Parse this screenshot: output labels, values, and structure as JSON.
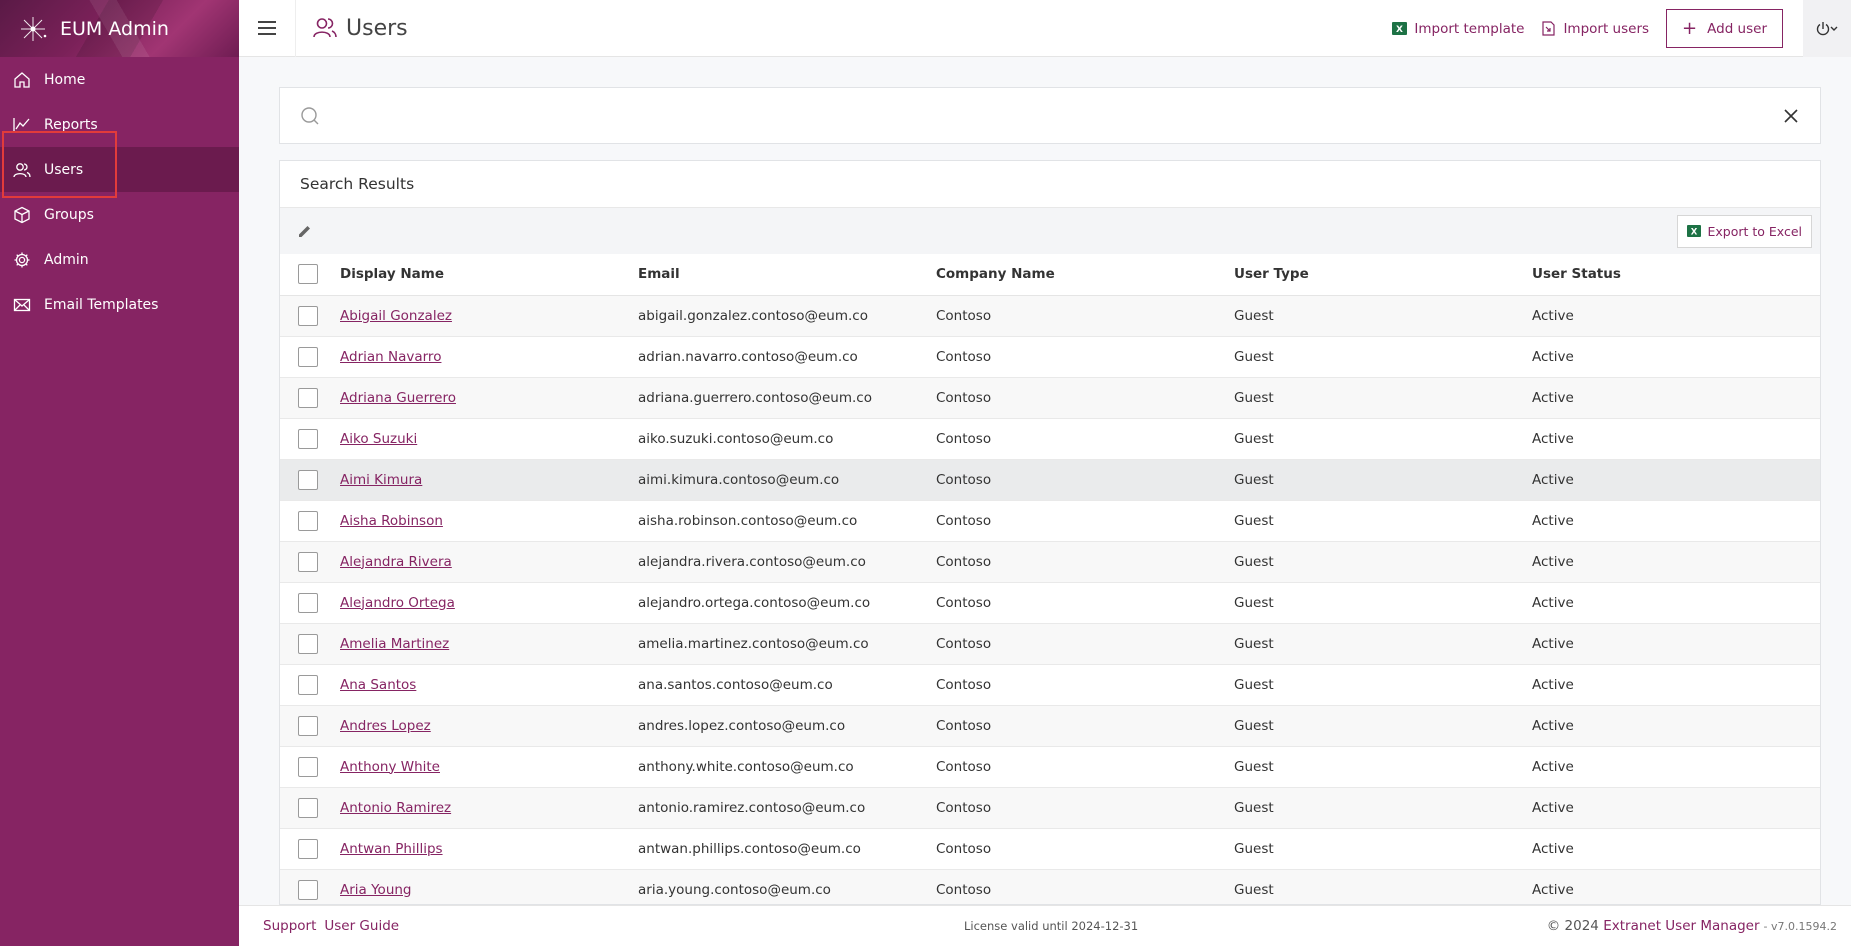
{
  "app": {
    "title": "EUM Admin"
  },
  "sidebar": {
    "items": [
      {
        "label": "Home",
        "icon": "home-icon"
      },
      {
        "label": "Reports",
        "icon": "chart-line-icon"
      },
      {
        "label": "Users",
        "icon": "users-icon",
        "active": true
      },
      {
        "label": "Groups",
        "icon": "cube-icon"
      },
      {
        "label": "Admin",
        "icon": "gear-icon"
      },
      {
        "label": "Email Templates",
        "icon": "envelope-icon"
      }
    ]
  },
  "header": {
    "page_title": "Users",
    "import_template_label": "Import template",
    "import_users_label": "Import users",
    "add_user_label": "Add user"
  },
  "search": {
    "value": "",
    "placeholder": ""
  },
  "results": {
    "title": "Search Results",
    "export_label": "Export to Excel",
    "columns": [
      "Display Name",
      "Email",
      "Company Name",
      "User Type",
      "User Status"
    ],
    "rows": [
      {
        "name": "Abigail Gonzalez",
        "email": "abigail.gonzalez.contoso@eum.co",
        "company": "Contoso",
        "type": "Guest",
        "status": "Active"
      },
      {
        "name": "Adrian Navarro",
        "email": "adrian.navarro.contoso@eum.co",
        "company": "Contoso",
        "type": "Guest",
        "status": "Active"
      },
      {
        "name": "Adriana Guerrero",
        "email": "adriana.guerrero.contoso@eum.co",
        "company": "Contoso",
        "type": "Guest",
        "status": "Active"
      },
      {
        "name": "Aiko Suzuki",
        "email": "aiko.suzuki.contoso@eum.co",
        "company": "Contoso",
        "type": "Guest",
        "status": "Active"
      },
      {
        "name": "Aimi Kimura",
        "email": "aimi.kimura.contoso@eum.co",
        "company": "Contoso",
        "type": "Guest",
        "status": "Active"
      },
      {
        "name": "Aisha Robinson",
        "email": "aisha.robinson.contoso@eum.co",
        "company": "Contoso",
        "type": "Guest",
        "status": "Active"
      },
      {
        "name": "Alejandra Rivera",
        "email": "alejandra.rivera.contoso@eum.co",
        "company": "Contoso",
        "type": "Guest",
        "status": "Active"
      },
      {
        "name": "Alejandro Ortega",
        "email": "alejandro.ortega.contoso@eum.co",
        "company": "Contoso",
        "type": "Guest",
        "status": "Active"
      },
      {
        "name": "Amelia Martinez",
        "email": "amelia.martinez.contoso@eum.co",
        "company": "Contoso",
        "type": "Guest",
        "status": "Active"
      },
      {
        "name": "Ana Santos",
        "email": "ana.santos.contoso@eum.co",
        "company": "Contoso",
        "type": "Guest",
        "status": "Active"
      },
      {
        "name": "Andres Lopez",
        "email": "andres.lopez.contoso@eum.co",
        "company": "Contoso",
        "type": "Guest",
        "status": "Active"
      },
      {
        "name": "Anthony White",
        "email": "anthony.white.contoso@eum.co",
        "company": "Contoso",
        "type": "Guest",
        "status": "Active"
      },
      {
        "name": "Antonio Ramirez",
        "email": "antonio.ramirez.contoso@eum.co",
        "company": "Contoso",
        "type": "Guest",
        "status": "Active"
      },
      {
        "name": "Antwan Phillips",
        "email": "antwan.phillips.contoso@eum.co",
        "company": "Contoso",
        "type": "Guest",
        "status": "Active"
      },
      {
        "name": "Aria Young",
        "email": "aria.young.contoso@eum.co",
        "company": "Contoso",
        "type": "Guest",
        "status": "Active"
      }
    ]
  },
  "footer": {
    "support_label": "Support",
    "guide_label": "User Guide",
    "license_text": "License valid until 2024-12-31",
    "copyright_prefix": "© 2024",
    "copyright_brand": "Extranet User Manager",
    "version": "- v7.0.1594.2"
  },
  "colors": {
    "brand": "#862463",
    "sidebar_active": "#6b1b4e",
    "highlight": "#e23b3b"
  }
}
